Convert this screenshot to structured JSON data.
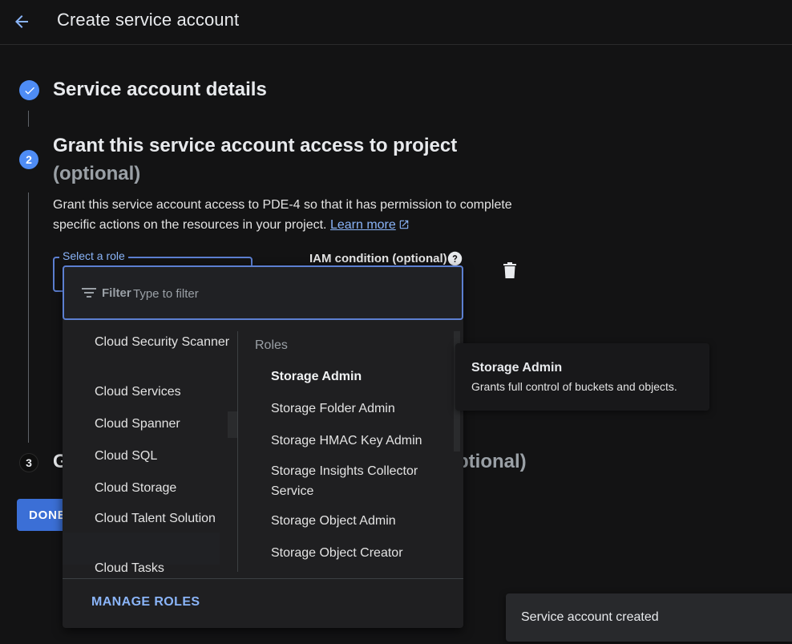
{
  "header": {
    "title": "Create service account"
  },
  "step1": {
    "title": "Service account details"
  },
  "step2": {
    "number": "2",
    "title": "Grant this service account access to project",
    "optional": "(optional)",
    "description": "Grant this service account access to PDE-4 so that it has permission to complete specific actions on the resources in your project.",
    "learn_more": "Learn more"
  },
  "step3": {
    "number": "3",
    "title_visible_left": "G",
    "title_visible_right": "ptional)"
  },
  "done_button": "DONE",
  "role_field": {
    "label": "Select a role"
  },
  "iam_condition": {
    "label": "IAM condition (optional)"
  },
  "role_picker": {
    "filter_label": "Filter",
    "filter_placeholder": "Type to filter",
    "services": [
      "Cloud Security Scanner",
      "Cloud Services",
      "Cloud Spanner",
      "Cloud SQL",
      "Cloud Storage",
      "Cloud Talent Solution",
      "Cloud Tasks"
    ],
    "selected_service": "Cloud Storage",
    "roles_heading": "Roles",
    "roles": [
      "Storage Admin",
      "Storage Folder Admin",
      "Storage HMAC Key Admin",
      "Storage Insights Collector Service",
      "Storage Object Admin",
      "Storage Object Creator"
    ],
    "highlighted_role": "Storage Admin",
    "manage_roles": "MANAGE ROLES"
  },
  "tooltip": {
    "title": "Storage Admin",
    "description": "Grants full control of buckets and objects."
  },
  "snackbar": {
    "message": "Service account created"
  },
  "colors": {
    "accent": "#8ab4f8",
    "primary_button": "#3b6fd6",
    "step_active": "#4e8cf5",
    "background": "#131314"
  },
  "icons": {
    "back": "arrow-back-icon",
    "step_done": "check-icon",
    "help": "help-icon",
    "delete": "trash-icon",
    "filter": "filter-icon",
    "external": "open-in-new-icon"
  }
}
